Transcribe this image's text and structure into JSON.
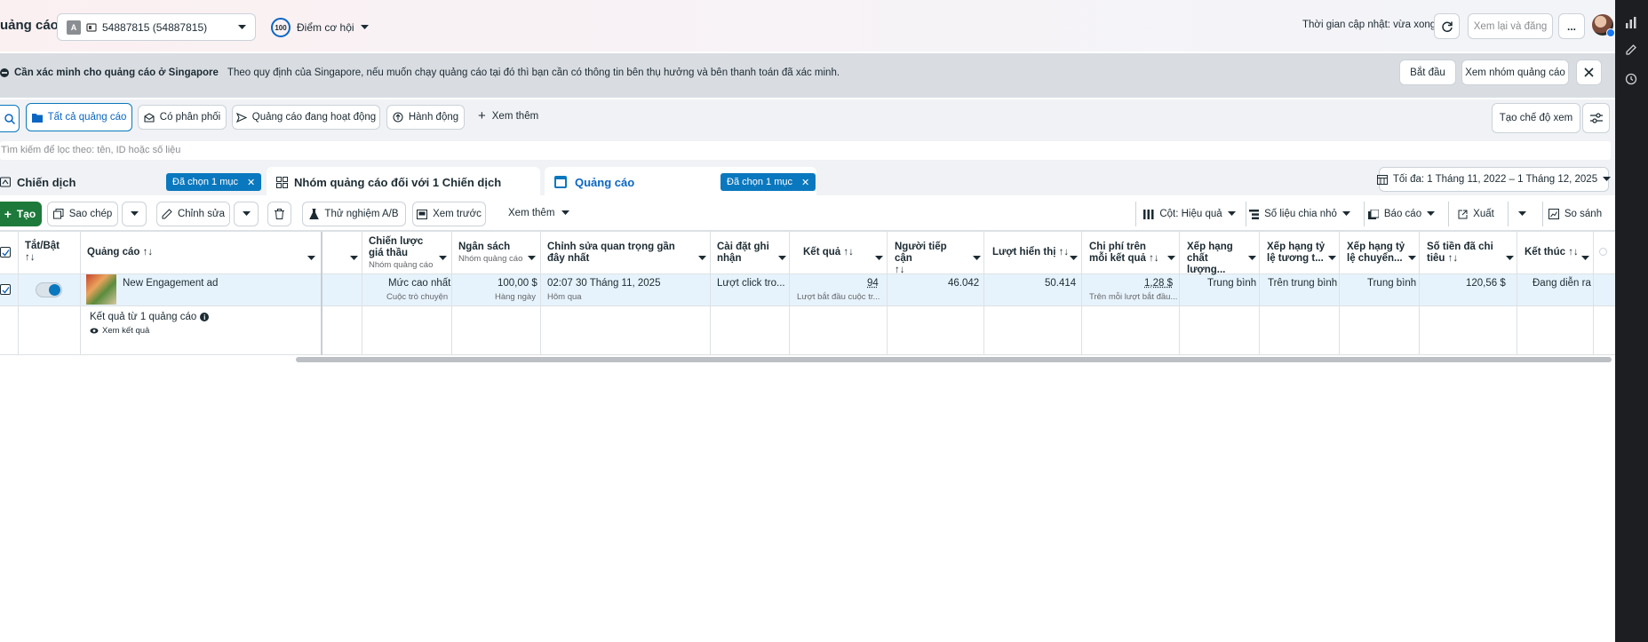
{
  "header": {
    "title": "uảng cáo",
    "account_badge": "A",
    "account_name": "54887815 (54887815)",
    "score_badge": "100",
    "score_label": "Điểm cơ hội",
    "update_time": "Thời gian cập nhật: vừa xong",
    "review_publish": "Xem lại và đăng",
    "more": "..."
  },
  "banner": {
    "title": "Cần xác minh cho quảng cáo ở Singapore",
    "text": "Theo quy định của Singapore, nếu muốn chạy quảng cáo tại đó thì bạn cần có thông tin bên thụ hưởng và bên thanh toán đã xác minh.",
    "start": "Bắt đầu",
    "view_group": "Xem nhóm quảng cáo"
  },
  "filters": {
    "all_ads": "Tất cả quảng cáo",
    "delivered": "Có phân phối",
    "active_ads": "Quảng cáo đang hoạt động",
    "actions": "Hành động",
    "see_more": "Xem thêm",
    "create_view": "Tạo chế độ xem",
    "search_placeholder": "Tìm kiếm để lọc theo: tên, ID hoặc số liệu"
  },
  "tabs": {
    "campaigns": "Chiến dịch",
    "campaigns_chip": "Đã chọn 1 mục",
    "adsets": "Nhóm quảng cáo đối với 1 Chiến dịch",
    "ads": "Quảng cáo",
    "ads_chip": "Đã chọn 1 mục",
    "date_range": "Tối đa: 1 Tháng 11, 2022 – 1 Tháng 12, 2025"
  },
  "toolbar": {
    "create": "Tạo",
    "copy": "Sao chép",
    "edit": "Chỉnh sửa",
    "ab_test": "Thử nghiệm A/B",
    "preview": "Xem trước",
    "see_more": "Xem thêm",
    "columns": "Cột: Hiệu quả",
    "breakdown": "Số liệu chia nhỏ",
    "reports": "Báo cáo",
    "export": "Xuất",
    "compare": "So sánh"
  },
  "table": {
    "headers": {
      "toggle": "Tắt/Bật",
      "ad": "Quảng cáo",
      "bid": "Chiến lược giá thầu",
      "bid_sub": "Nhóm quảng cáo",
      "budget": "Ngân sách",
      "budget_sub": "Nhóm quảng cáo",
      "last_edit": "Chỉnh sửa quan trọng gần đây nhất",
      "attribution": "Cài đặt ghi nhận",
      "results": "Kết quả",
      "reach": "Người tiếp cận",
      "impressions": "Lượt hiển thị",
      "cost_per": "Chi phí trên mỗi kết quả",
      "quality": "Xếp hạng chất lượng...",
      "engagement_rank": "Xếp hạng tỷ lệ tương t...",
      "conversion_rank": "Xếp hạng tỷ lệ chuyển...",
      "spent": "Số tiền đã chi tiêu",
      "end": "Kết thúc"
    },
    "row": {
      "name": "New Engagement ad",
      "bid": "Mức cao nhất",
      "bid_sub": "Cuộc trò chuyện",
      "budget": "100,00 $",
      "budget_sub": "Hàng ngày",
      "last_edit": "02:07 30 Tháng 11, 2025",
      "last_edit_sub": "Hôm qua",
      "attribution": "Lượt click tro...",
      "results": "94",
      "results_sub": "Lượt bắt đầu cuộc tr...",
      "reach": "46.042",
      "impressions": "50.414",
      "cost_per": "1,28 $",
      "cost_per_sub": "Trên mỗi lượt bắt đầu...",
      "quality": "Trung bình",
      "engagement_rank": "Trên trung bình",
      "conversion_rank": "Trung bình",
      "spent": "120,56 $",
      "end": "Đang diễn ra"
    },
    "summary": {
      "label": "Kết quả từ 1 quảng cáo",
      "link": "Xem kết quả"
    }
  }
}
